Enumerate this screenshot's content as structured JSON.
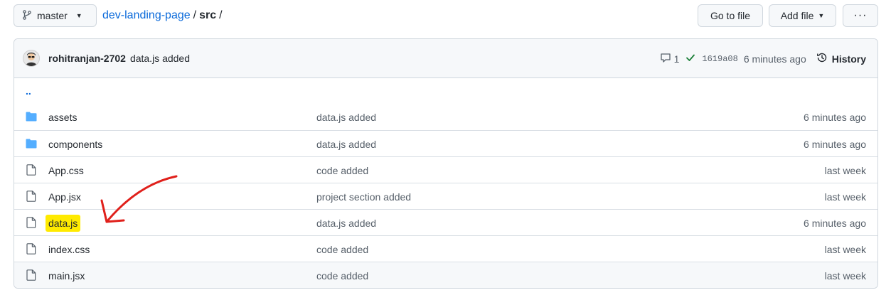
{
  "header": {
    "branch": "master",
    "repo": "dev-landing-page",
    "sep1": "/",
    "dir": "src",
    "sep2": "/",
    "goto": "Go to file",
    "add": "Add file",
    "more": "···"
  },
  "commit": {
    "author": "rohitranjan-2702",
    "message": "data.js added",
    "comments": "1",
    "sha": "1619a08",
    "time": "6 minutes ago",
    "history": "History"
  },
  "parent": "..",
  "files": [
    {
      "type": "folder",
      "name": "assets",
      "message": "data.js added",
      "age": "6 minutes ago"
    },
    {
      "type": "folder",
      "name": "components",
      "message": "data.js added",
      "age": "6 minutes ago"
    },
    {
      "type": "file",
      "name": "App.css",
      "message": "code added",
      "age": "last week"
    },
    {
      "type": "file",
      "name": "App.jsx",
      "message": "project section added",
      "age": "last week"
    },
    {
      "type": "file",
      "name": "data.js",
      "message": "data.js added",
      "age": "6 minutes ago",
      "highlighted": true
    },
    {
      "type": "file",
      "name": "index.css",
      "message": "code added",
      "age": "last week"
    },
    {
      "type": "file",
      "name": "main.jsx",
      "message": "code added",
      "age": "last week"
    }
  ],
  "colors": {
    "link": "#0969da",
    "folder": "#54aeff",
    "highlight": "#ffea00",
    "arrow": "#e0201b",
    "check": "#1a7f37"
  }
}
